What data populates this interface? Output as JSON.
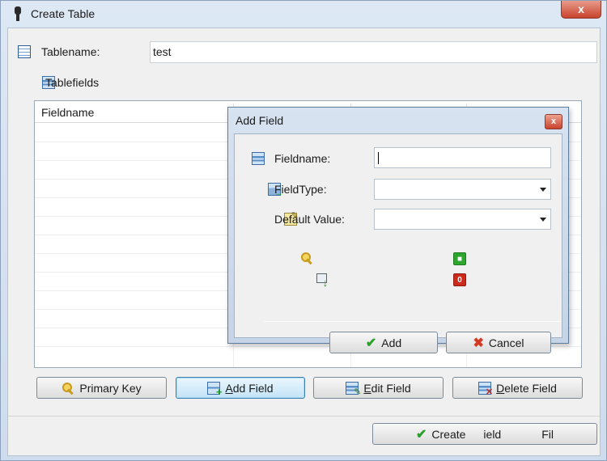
{
  "window": {
    "title": "Create Table",
    "close_glyph": "x"
  },
  "form": {
    "tablename_label": "Tablename:",
    "tablename_value": "test",
    "tablefields_label": "Tablefields"
  },
  "grid": {
    "columns": [
      "Fieldname"
    ]
  },
  "buttons": {
    "primary_key": "Primary Key",
    "add_field_u": "A",
    "add_field_rest": "dd Field",
    "edit_field_u": "E",
    "edit_field_rest": "dit Field",
    "delete_field_u": "D",
    "delete_field_rest": "elete Field",
    "create": "Create",
    "create_overlay": "ield",
    "fill": "Fil"
  },
  "dialog": {
    "title": "Add Field",
    "close_glyph": "x",
    "fieldname_label": "Fieldname:",
    "fieldname_value": "",
    "fieldtype_label": "FieldType:",
    "fieldtype_value": "",
    "default_label": "Default Value:",
    "default_value": "",
    "checkbox_on_glyph": "■",
    "checkbox_off_glyph": "0",
    "add_label": "Add",
    "cancel_label": "Cancel"
  },
  "colors": {
    "accent": "#3c7fb1",
    "check_on": "#2ea52e",
    "check_off": "#cc2a1b"
  }
}
